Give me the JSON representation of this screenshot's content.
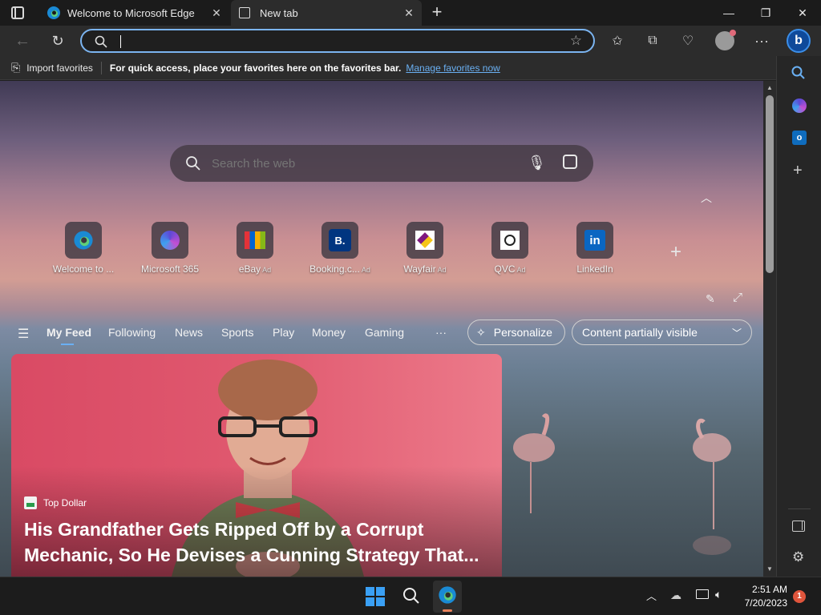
{
  "tabs": [
    {
      "title": "Welcome to Microsoft Edge"
    },
    {
      "title": "New tab"
    }
  ],
  "address": {
    "value": "",
    "placeholder": ""
  },
  "favorites_bar": {
    "import_label": "Import favorites",
    "message": "For quick access, place your favorites here on the favorites bar.",
    "manage_link": "Manage favorites now"
  },
  "search": {
    "placeholder": "Search the web"
  },
  "tiles": [
    {
      "label": "Welcome to ...",
      "ad": ""
    },
    {
      "label": "Microsoft 365",
      "ad": ""
    },
    {
      "label": "eBay",
      "ad": "Ad"
    },
    {
      "label": "Booking.c...",
      "ad": "Ad"
    },
    {
      "label": "Wayfair",
      "ad": "Ad"
    },
    {
      "label": "QVC",
      "ad": "Ad"
    },
    {
      "label": "LinkedIn",
      "ad": ""
    }
  ],
  "feed_nav": {
    "items": [
      "My Feed",
      "Following",
      "News",
      "Sports",
      "Play",
      "Money",
      "Gaming"
    ],
    "more": "···",
    "personalize": "Personalize",
    "content_visibility": "Content partially visible"
  },
  "card": {
    "source": "Top Dollar",
    "headline_line1": "His Grandfather Gets Ripped Off by a Corrupt",
    "headline_line2": "Mechanic, So He Devises a Cunning Strategy That..."
  },
  "taskbar": {
    "time": "2:51 AM",
    "date": "7/20/2023",
    "notification_count": "1"
  },
  "colors": {
    "accent": "#7bb4f0",
    "link": "#6ab0f3",
    "notification_badge": "#e0553c"
  }
}
